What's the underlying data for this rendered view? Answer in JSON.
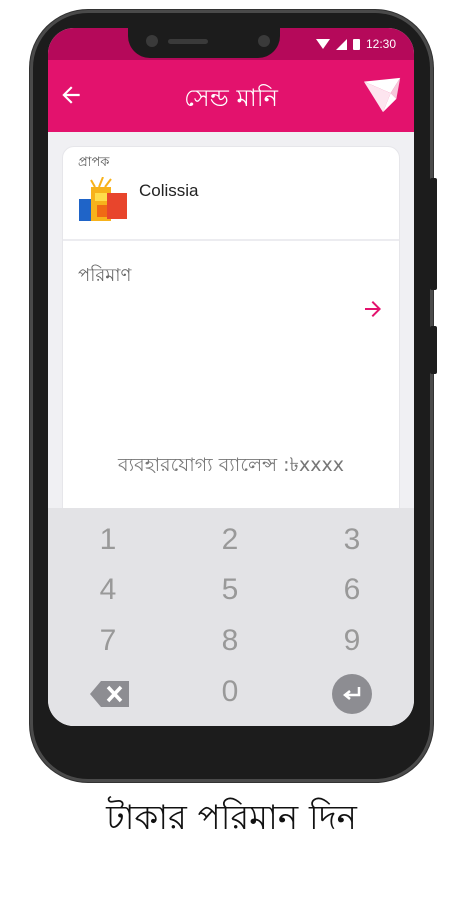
{
  "status_bar": {
    "time": "12:30"
  },
  "app_bar": {
    "title": "সেন্ড মানি"
  },
  "recipient": {
    "label": "প্রাপক",
    "name": "Colissia"
  },
  "amount": {
    "label": "পরিমাণ"
  },
  "balance": {
    "text": "ব্যবহারযোগ্য ব্যালেন্স :৳xxxx"
  },
  "keypad": {
    "keys": [
      "1",
      "2",
      "3",
      "4",
      "5",
      "6",
      "7",
      "8",
      "9",
      "0"
    ]
  },
  "caption": {
    "text": "টাকার পরিমান দিন"
  },
  "colors": {
    "primary": "#e3126d",
    "status_bar": "#b5095a",
    "keypad_bg": "#e3e3e6"
  }
}
